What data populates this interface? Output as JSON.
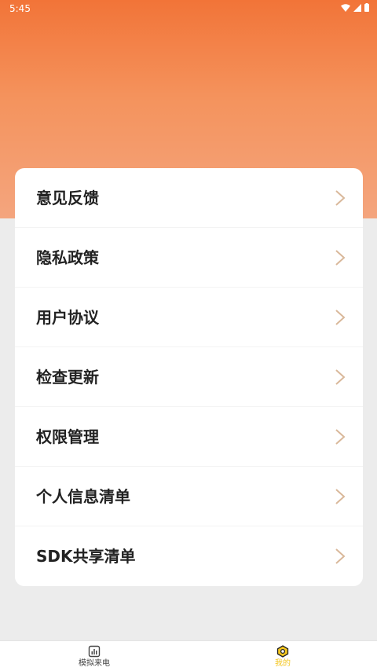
{
  "status_bar": {
    "time": "5:45"
  },
  "menu": {
    "items": [
      {
        "label": "意见反馈"
      },
      {
        "label": "隐私政策"
      },
      {
        "label": "用户协议"
      },
      {
        "label": "检查更新"
      },
      {
        "label": "权限管理"
      },
      {
        "label": "个人信息清单"
      },
      {
        "label": "SDK共享清单"
      }
    ]
  },
  "bottom_nav": {
    "items": [
      {
        "label": "模拟来电",
        "icon": "bar-chart-icon",
        "active": false
      },
      {
        "label": "我的",
        "icon": "hexagon-icon",
        "active": true
      }
    ]
  },
  "colors": {
    "header_top": "#f27438",
    "header_bottom": "#f4a57e",
    "chevron": "#d9b89a",
    "nav_inactive": "#444444",
    "nav_active": "#f3c51d"
  }
}
